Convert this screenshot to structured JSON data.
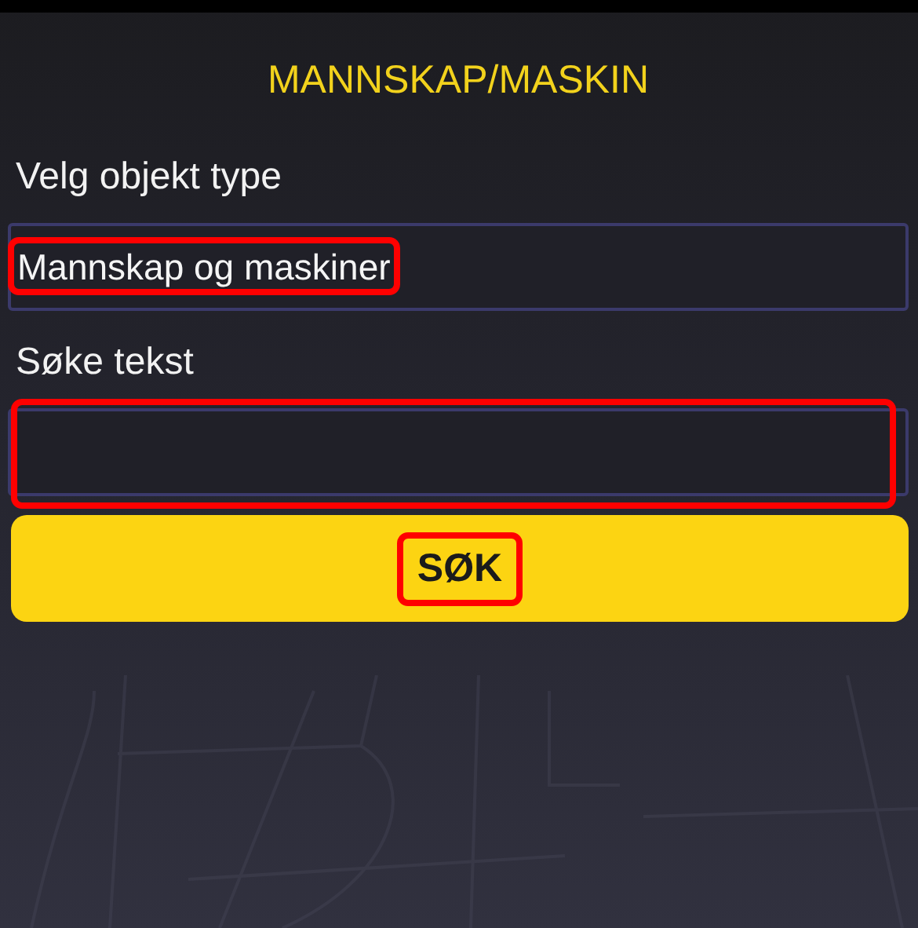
{
  "title": "MANNSKAP/MASKIN",
  "object_type": {
    "label": "Velg objekt type",
    "value": "Mannskap og maskiner",
    "highlighted": true
  },
  "search": {
    "label": "Søke tekst",
    "highlighted": true
  },
  "search_button": {
    "label": "SØK",
    "highlighted": true
  }
}
